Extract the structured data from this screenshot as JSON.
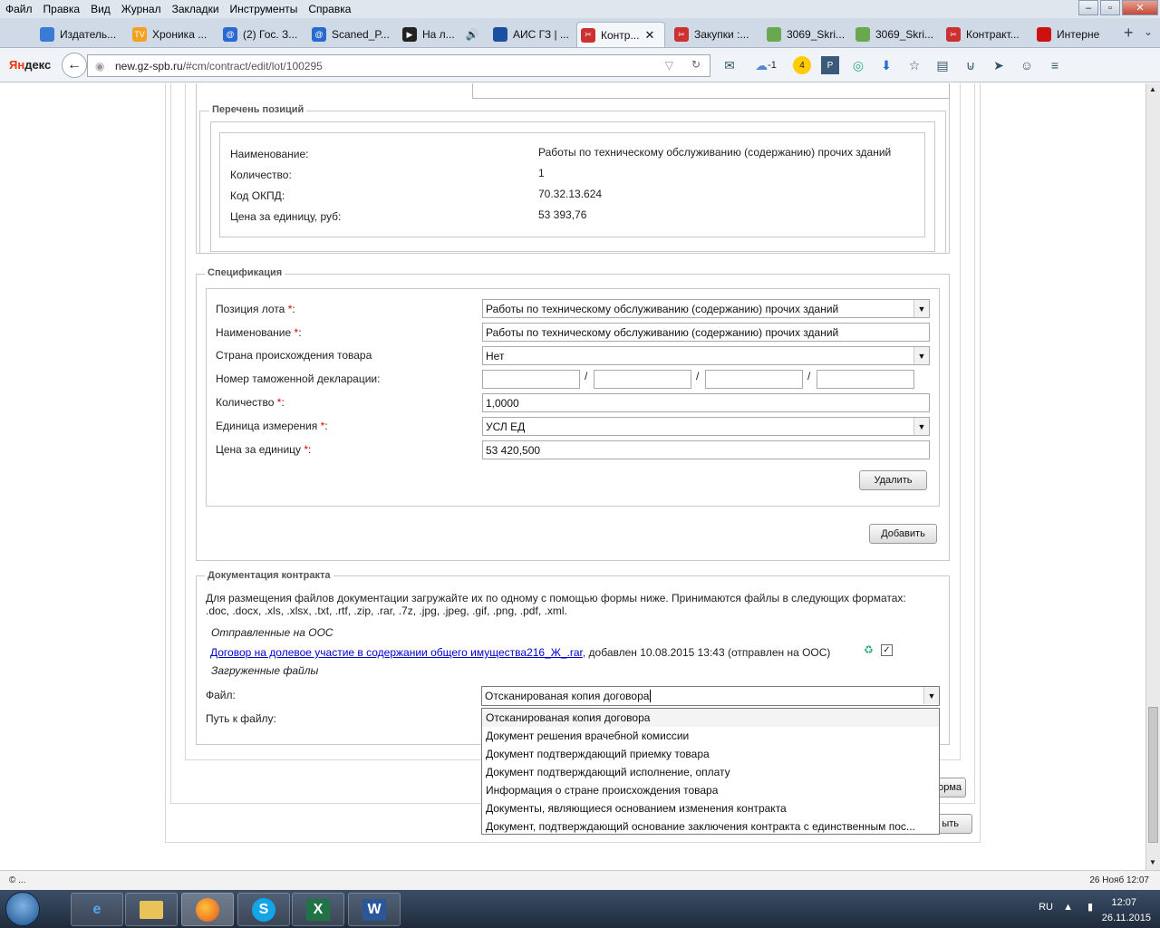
{
  "menu": [
    "Файл",
    "Правка",
    "Вид",
    "Журнал",
    "Закладки",
    "Инструменты",
    "Справка"
  ],
  "tabs": [
    {
      "label": "Издатель...",
      "color": "#3a7bd5"
    },
    {
      "label": "Хроника ...",
      "color": "#f4a020"
    },
    {
      "label": "(2) Гос. З...",
      "color": "#2a6ad0"
    },
    {
      "label": "Scaned_P...",
      "color": "#2a6ad0"
    },
    {
      "label": "На л...",
      "color": "#222222"
    },
    {
      "label": "АИС ГЗ | ...",
      "color": "#1b4fa0"
    },
    {
      "label": "Контр...",
      "color": "#cc3030"
    },
    {
      "label": "Закупки :...",
      "color": "#cc3030"
    },
    {
      "label": "3069_Skri...",
      "color": "#6aa84f"
    },
    {
      "label": "3069_Skri...",
      "color": "#6aa84f"
    },
    {
      "label": "Контракт...",
      "color": "#cc3030"
    },
    {
      "label": "Интерне",
      "color": "#cc1111"
    }
  ],
  "browser": {
    "brand_left": "Ян",
    "brand_right": "декс",
    "url_domain": "new.gz-spb.ru",
    "url_path": "/#cm/contract/edit/lot/100295",
    "weather": "-1",
    "badge": "4"
  },
  "positions": {
    "legend": "Перечень позиций",
    "rows": [
      {
        "label": "Наименование:",
        "value": "Работы по техническому обслуживанию (содержанию) прочих зданий"
      },
      {
        "label": "Количество:",
        "value": "1"
      },
      {
        "label": "Код ОКПД:",
        "value": "70.32.13.624"
      },
      {
        "label": "Цена за единицу, руб:",
        "value": "53 393,76"
      }
    ]
  },
  "spec": {
    "legend": "Спецификация",
    "lot_position_label": "Позиция лота",
    "lot_position_value": "Работы по техническому обслуживанию (содержанию) прочих зданий",
    "name_label": "Наименование",
    "name_value": "Работы по техническому обслуживанию (содержанию) прочих зданий",
    "country_label": "Страна происхождения товара",
    "country_value": "Нет",
    "customs_label": "Номер таможенной декларации:",
    "sep": "/",
    "qty_label": "Количество",
    "qty_value": "1,0000",
    "unit_label": "Единица измерения",
    "unit_value": "УСЛ ЕД",
    "price_label": "Цена за единицу",
    "price_value": "53 420,500",
    "required_mark": "*",
    "colon": ":",
    "delete_btn": "Удалить",
    "add_btn": "Добавить"
  },
  "docs": {
    "legend": "Документация контракта",
    "info_line1": "Для размещения файлов документации загружайте их по одному с помощью формы ниже. Принимаются файлы в следующих форматах:",
    "info_line2": ".doc, .docx, .xls, .xlsx, .txt, .rtf, .zip, .rar, .7z, .jpg, .jpeg, .gif, .png, .pdf, .xml.",
    "sent_heading": "Отправленные на ООС",
    "file_link": "Договор на долевое участие в содержании общего имущества216_Ж_.rar",
    "file_meta": ", добавлен 10.08.2015 13:43 (отправлен на ООС)",
    "uploaded_heading": "Загруженные файлы",
    "file_label": "Файл:",
    "path_label": "Путь к файлу:",
    "file_type_value": "Отсканированая копия договора",
    "options": [
      "Отсканированая копия договора",
      "Документ решения врачебной комиссии",
      "Документ подтверждающий приемку товара",
      "Документ подтверждающий исполнение, оплату",
      "Информация о стране происхождения товара",
      "Документы, являющиеся основанием изменения контракта",
      "Документ, подтверждающий основание заключения контракта с единственным пос..."
    ],
    "partial_btn1": "орма",
    "partial_btn2": "ыть"
  },
  "status": {
    "left": "© ...",
    "right": "26 Нояб 12:07"
  },
  "taskbar": {
    "apps": [
      "e",
      "",
      "",
      "S",
      "X",
      "W"
    ],
    "lang": "RU",
    "time": "12:07",
    "date": "26.11.2015"
  }
}
